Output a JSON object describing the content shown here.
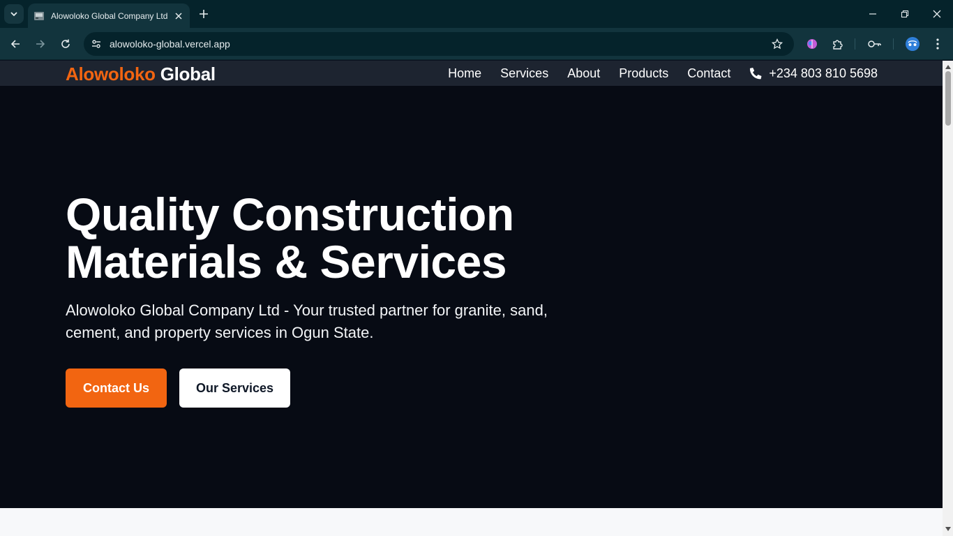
{
  "browser": {
    "tab_title": "Alowoloko Global Company Ltd",
    "url": "alowoloko-global.vercel.app"
  },
  "site": {
    "logo_part1": "Alowoloko",
    "logo_part2": "Global",
    "nav": [
      "Home",
      "Services",
      "About",
      "Products",
      "Contact"
    ],
    "phone": "+234 803 810 5698"
  },
  "hero": {
    "title": "Quality Construction Materials & Services",
    "subtitle": "Alowoloko Global Company Ltd - Your trusted partner for granite, sand, cement, and property services in Ogun State.",
    "primary_button": "Contact Us",
    "secondary_button": "Our Services"
  },
  "colors": {
    "accent": "#f26511",
    "hero_bg": "#070b14",
    "header_bg": "#1d2430",
    "chrome_bg": "#12343d"
  }
}
